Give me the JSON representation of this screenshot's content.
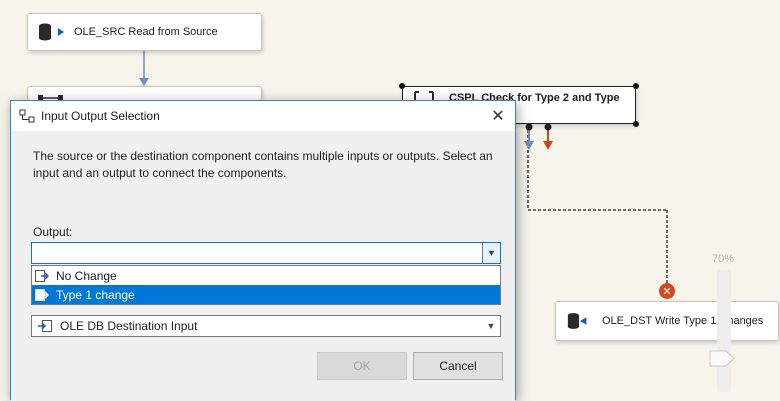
{
  "canvas": {
    "src_node_label": "OLE_SRC Read from Source",
    "split_node_label": "CSPL Check for Type 2 and Type",
    "dst_node_label": "OLE_DST Write Type 1 Changes",
    "zoom_level": "70%"
  },
  "dialog": {
    "title": "Input Output Selection",
    "description": "The source or the destination component contains multiple inputs or outputs. Select an input and an output to connect the components.",
    "output_label": "Output:",
    "output_value": "",
    "output_options": [
      "No Change",
      "Type 1 change"
    ],
    "selected_option": "Type 1 change",
    "input_value": "OLE DB Destination Input",
    "ok_label": "OK",
    "cancel_label": "Cancel"
  },
  "colors": {
    "accent": "#0078d7",
    "error_path": "#c8461a",
    "canvas_bg": "#f7f4ec"
  }
}
